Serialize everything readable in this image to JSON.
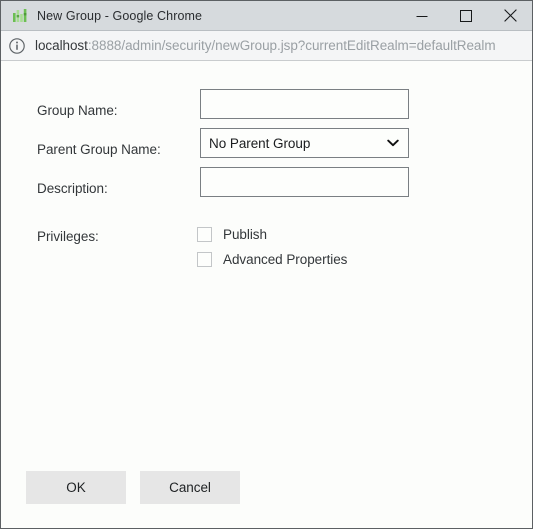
{
  "window": {
    "title": "New Group - Google Chrome",
    "favicon": "bar-chart-icon",
    "controls": {
      "minimize": "minimize-icon",
      "maximize": "maximize-icon",
      "close": "close-icon"
    }
  },
  "urlbar": {
    "security_icon": "info-circle-icon",
    "host": "localhost",
    "path": ":8888/admin/security/newGroup.jsp?currentEditRealm=defaultRealm",
    "full_url": "localhost:8888/admin/security/newGroup.jsp?currentEditRealm=defaultRealm"
  },
  "form": {
    "fields": [
      {
        "label": "Group Name:",
        "type": "text",
        "value": "",
        "placeholder": ""
      },
      {
        "label": "Parent Group Name:",
        "type": "select",
        "value": "No Parent Group",
        "options": [
          "No Parent Group"
        ]
      },
      {
        "label": "Description:",
        "type": "text",
        "value": "",
        "placeholder": ""
      }
    ],
    "privileges": {
      "label": "Privileges:",
      "items": [
        {
          "label": "Publish",
          "checked": false
        },
        {
          "label": "Advanced Properties",
          "checked": false
        }
      ]
    }
  },
  "actions": {
    "ok_label": "OK",
    "cancel_label": "Cancel"
  },
  "colors": {
    "titlebar_bg": "#d6dadd",
    "urlbar_bg": "#f4f5f6",
    "page_bg": "#fcfdfb",
    "button_bg": "#e6e6e6",
    "favicon_green": "#6cbf52",
    "text": "#33373a",
    "url_muted": "#9aa0a4"
  }
}
